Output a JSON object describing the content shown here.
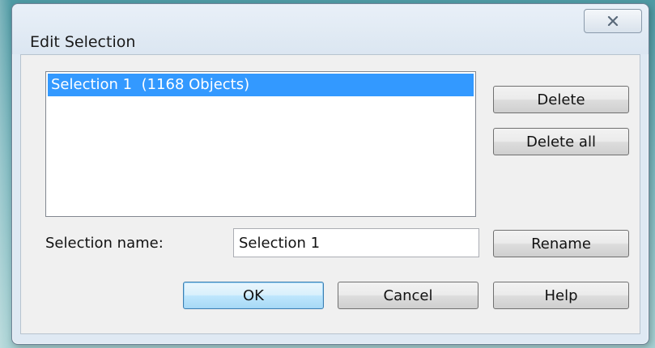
{
  "window": {
    "title": "Edit Selection",
    "close_icon": "close-icon"
  },
  "list": {
    "items": [
      {
        "label": "Selection 1  (1168 Objects)",
        "selected": true
      }
    ]
  },
  "buttons": {
    "delete": "Delete",
    "delete_all": "Delete all",
    "rename": "Rename",
    "ok": "OK",
    "cancel": "Cancel",
    "help": "Help"
  },
  "form": {
    "selection_name_label": "Selection name:",
    "selection_name_value": "Selection 1"
  },
  "colors": {
    "selection_highlight": "#3399ff",
    "default_button_accent": "#3c7fb1"
  }
}
